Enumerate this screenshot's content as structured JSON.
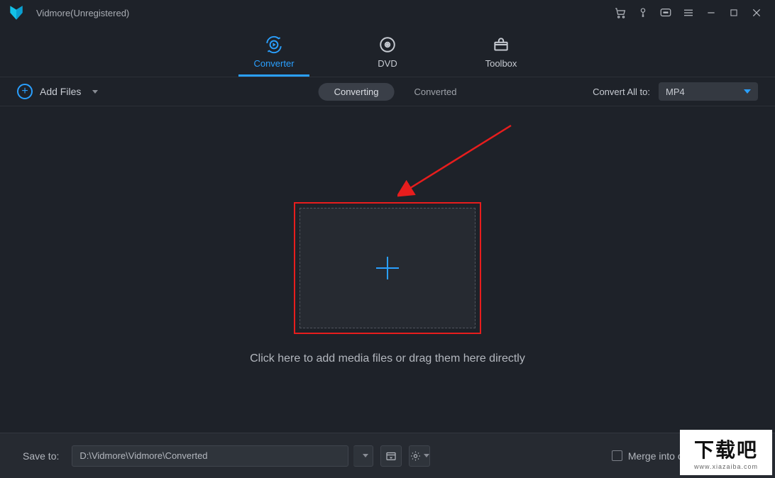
{
  "app": {
    "title": "Vidmore(Unregistered)"
  },
  "tabs": {
    "converter": "Converter",
    "dvd": "DVD",
    "toolbox": "Toolbox"
  },
  "toolbar": {
    "add_files": "Add Files",
    "converting": "Converting",
    "converted": "Converted",
    "convert_all_to": "Convert All to:",
    "format_value": "MP4"
  },
  "main": {
    "hint": "Click here to add media files or drag them here directly"
  },
  "bottom": {
    "save_to": "Save to:",
    "path": "D:\\Vidmore\\Vidmore\\Converted",
    "merge": "Merge into one file"
  },
  "watermark": {
    "big": "下载吧",
    "small": "www.xiazaiba.com"
  }
}
